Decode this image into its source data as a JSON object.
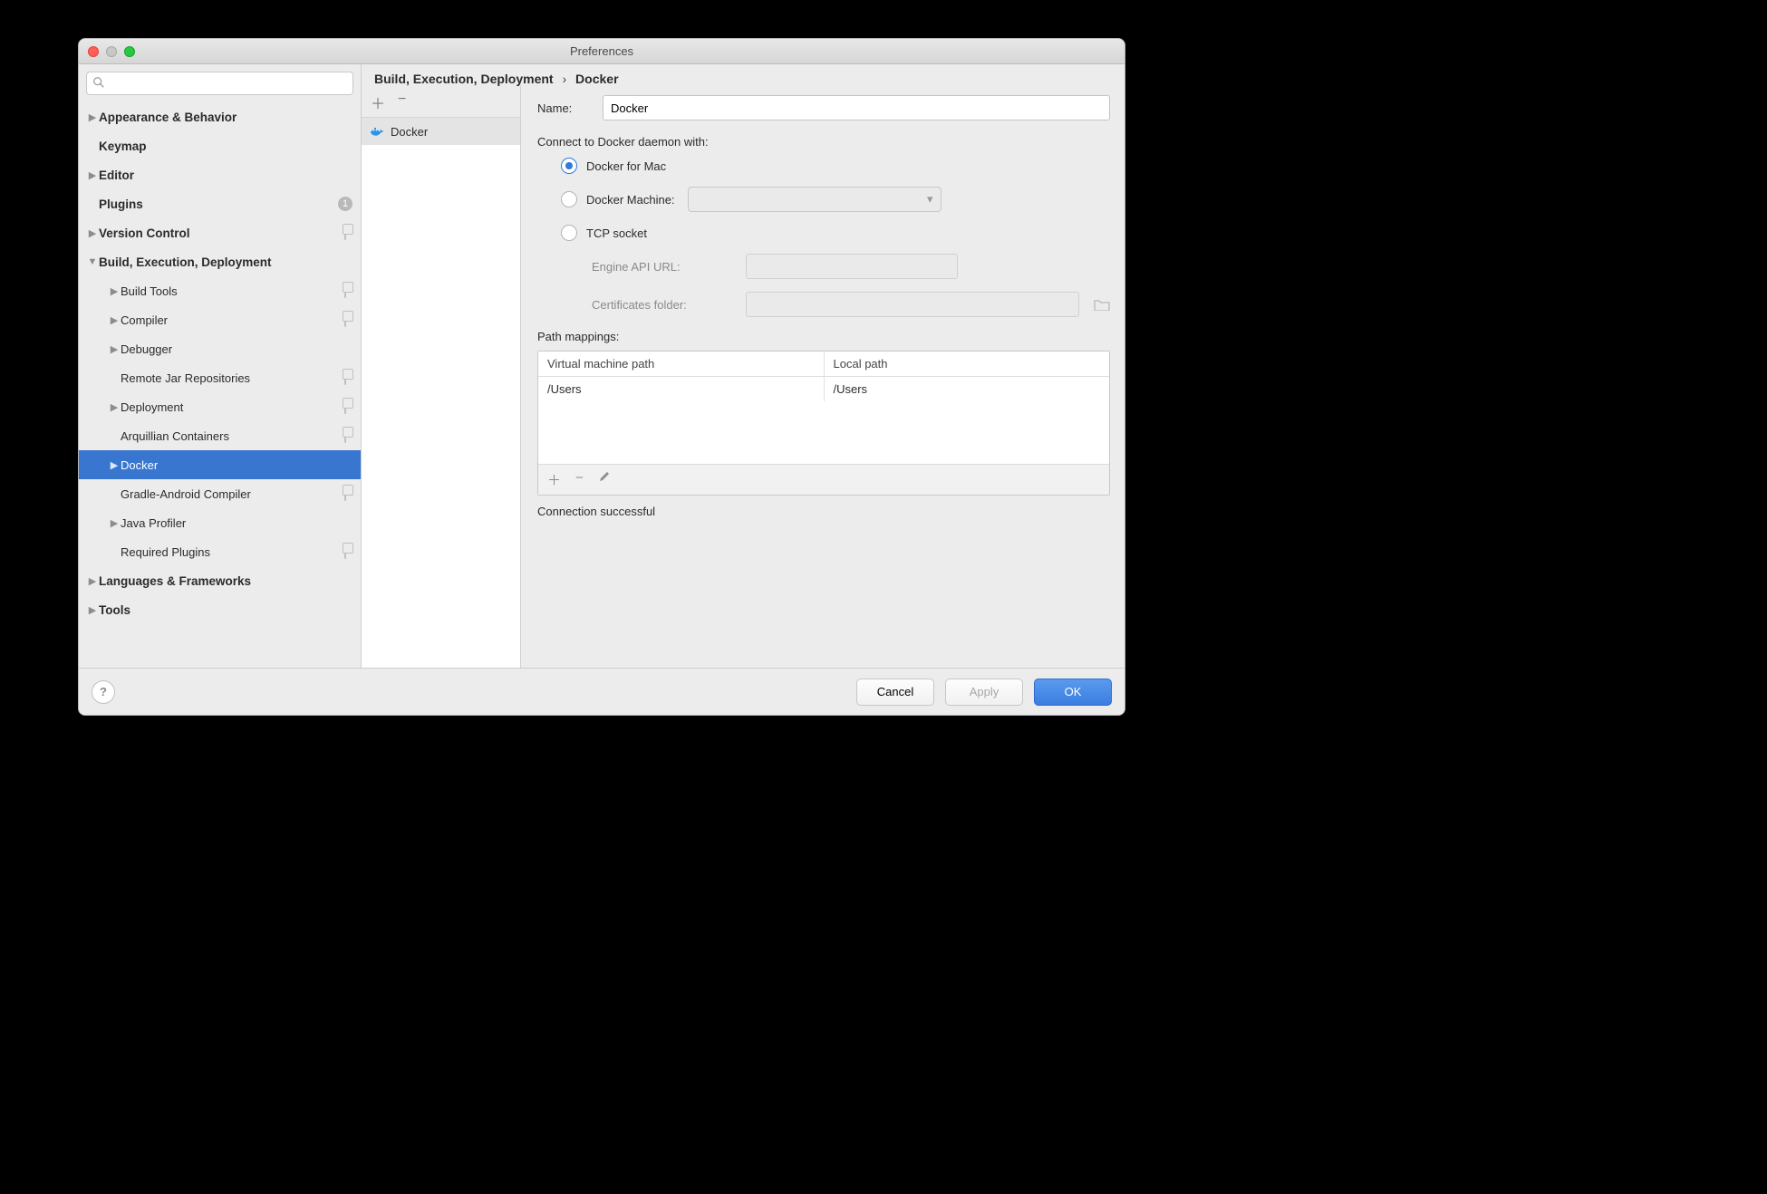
{
  "window_title": "Preferences",
  "sidebar": {
    "plugins_badge": "1",
    "items": [
      {
        "label": "Appearance & Behavior",
        "depth": 0,
        "bold": true,
        "arrow": "right",
        "marker": ""
      },
      {
        "label": "Keymap",
        "depth": 0,
        "bold": true,
        "arrow": "",
        "marker": ""
      },
      {
        "label": "Editor",
        "depth": 0,
        "bold": true,
        "arrow": "right",
        "marker": ""
      },
      {
        "label": "Plugins",
        "depth": 0,
        "bold": true,
        "arrow": "",
        "marker": "badge"
      },
      {
        "label": "Version Control",
        "depth": 0,
        "bold": true,
        "arrow": "right",
        "marker": "copy"
      },
      {
        "label": "Build, Execution, Deployment",
        "depth": 0,
        "bold": true,
        "arrow": "down",
        "marker": ""
      },
      {
        "label": "Build Tools",
        "depth": 1,
        "bold": false,
        "arrow": "right",
        "marker": "copy"
      },
      {
        "label": "Compiler",
        "depth": 1,
        "bold": false,
        "arrow": "right",
        "marker": "copy"
      },
      {
        "label": "Debugger",
        "depth": 1,
        "bold": false,
        "arrow": "right",
        "marker": ""
      },
      {
        "label": "Remote Jar Repositories",
        "depth": 1,
        "bold": false,
        "arrow": "",
        "marker": "copy"
      },
      {
        "label": "Deployment",
        "depth": 1,
        "bold": false,
        "arrow": "right",
        "marker": "copy"
      },
      {
        "label": "Arquillian Containers",
        "depth": 1,
        "bold": false,
        "arrow": "",
        "marker": "copy"
      },
      {
        "label": "Docker",
        "depth": 1,
        "bold": false,
        "arrow": "right",
        "marker": "",
        "selected": true
      },
      {
        "label": "Gradle-Android Compiler",
        "depth": 1,
        "bold": false,
        "arrow": "",
        "marker": "copy"
      },
      {
        "label": "Java Profiler",
        "depth": 1,
        "bold": false,
        "arrow": "right",
        "marker": ""
      },
      {
        "label": "Required Plugins",
        "depth": 1,
        "bold": false,
        "arrow": "",
        "marker": "copy"
      },
      {
        "label": "Languages & Frameworks",
        "depth": 0,
        "bold": true,
        "arrow": "right",
        "marker": ""
      },
      {
        "label": "Tools",
        "depth": 0,
        "bold": true,
        "arrow": "right",
        "marker": ""
      }
    ]
  },
  "breadcrumb": {
    "parent": "Build, Execution, Deployment",
    "current": "Docker"
  },
  "server_list_item": "Docker",
  "detail": {
    "name_label": "Name:",
    "name_value": "Docker",
    "connect_label": "Connect to Docker daemon with:",
    "radio1": "Docker for Mac",
    "radio2": "Docker Machine:",
    "radio3": "TCP socket",
    "engine_label": "Engine API URL:",
    "certs_label": "Certificates folder:",
    "path_label": "Path mappings:",
    "col1": "Virtual machine path",
    "col2": "Local path",
    "row_vm": "/Users",
    "row_local": "/Users",
    "status": "Connection successful"
  },
  "footer": {
    "cancel": "Cancel",
    "apply": "Apply",
    "ok": "OK"
  }
}
